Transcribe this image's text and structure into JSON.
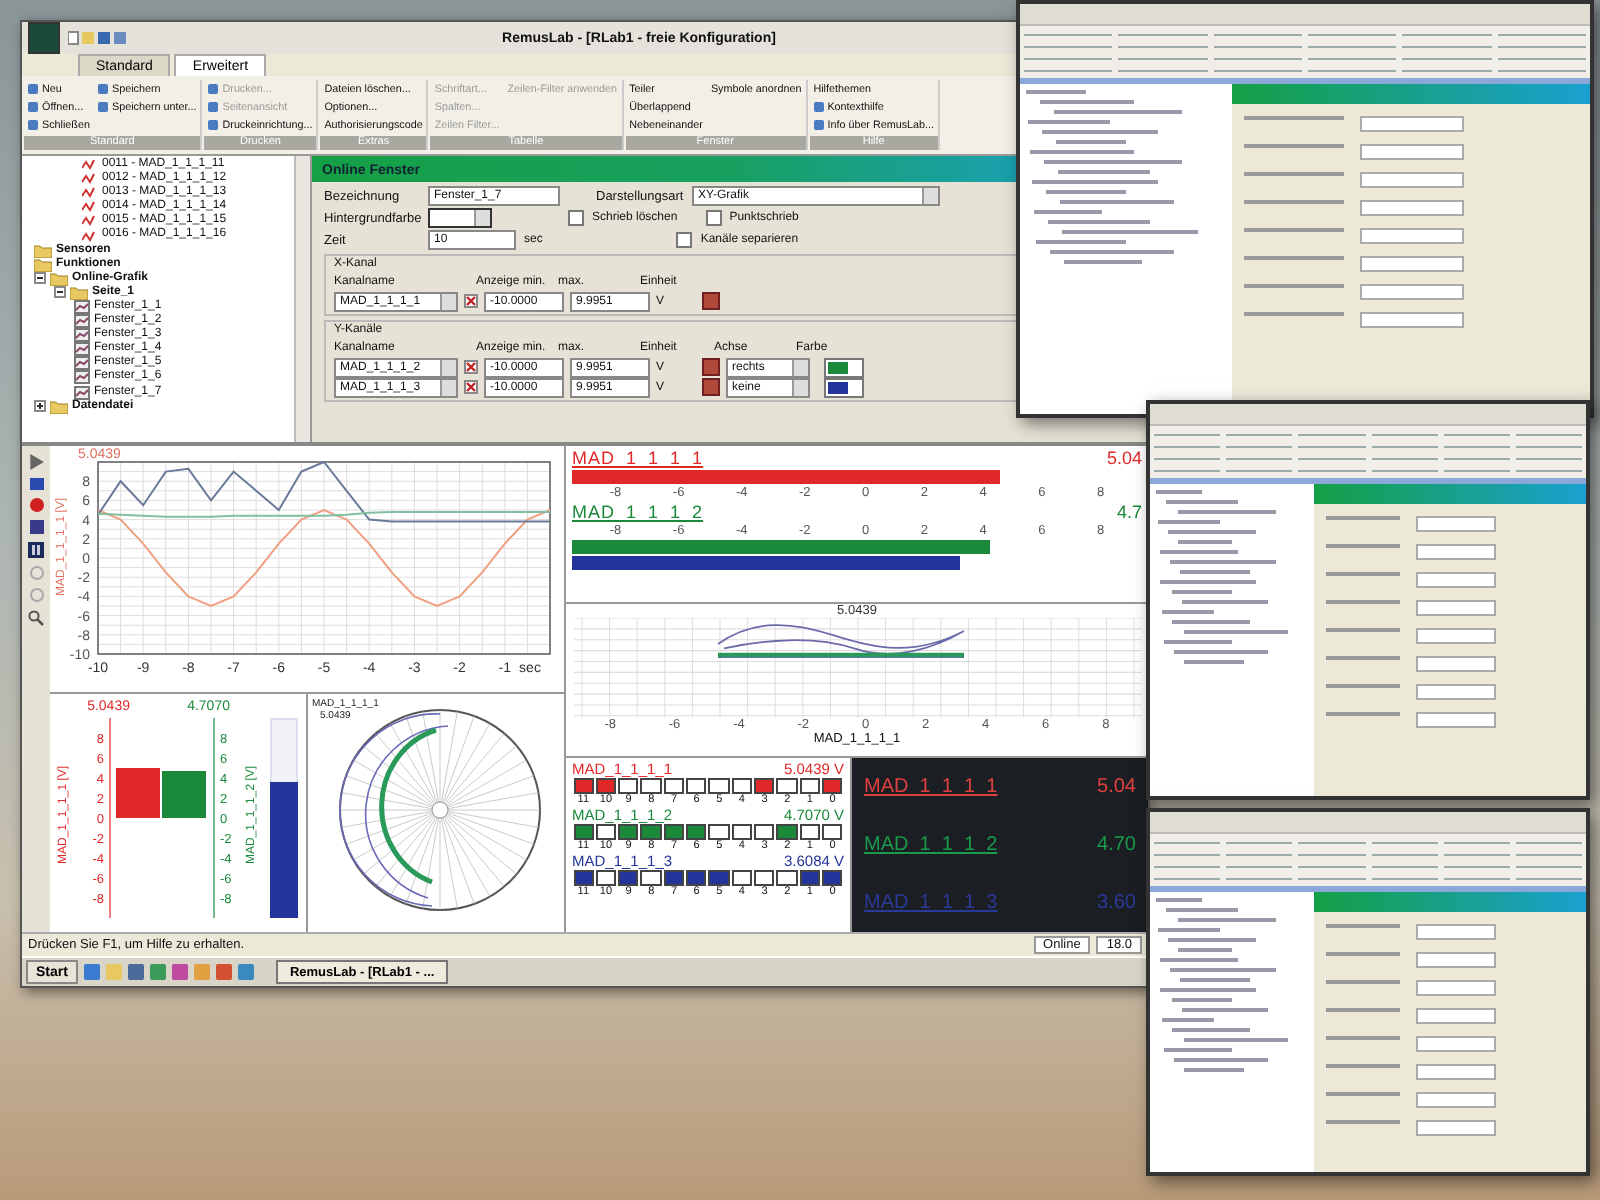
{
  "window": {
    "title": "RemusLab - [RLab1 - freie Konfiguration]"
  },
  "tabs": [
    {
      "label": "Standard",
      "selected": false
    },
    {
      "label": "Erweitert",
      "selected": true
    }
  ],
  "ribbon": [
    {
      "title": "Standard",
      "items": [
        {
          "label": "Neu",
          "disabled": false,
          "icon": true
        },
        {
          "label": "Öffnen...",
          "disabled": false,
          "icon": true
        },
        {
          "label": "Schließen",
          "disabled": false,
          "icon": true
        },
        {
          "label": "Speichern",
          "disabled": false,
          "icon": true
        },
        {
          "label": "Speichern unter...",
          "disabled": false,
          "icon": true
        }
      ]
    },
    {
      "title": "Drucken",
      "items": [
        {
          "label": "Drucken...",
          "disabled": true,
          "icon": true
        },
        {
          "label": "Seitenansicht",
          "disabled": true,
          "icon": true
        },
        {
          "label": "Druckeinrichtung...",
          "disabled": false,
          "icon": true
        }
      ]
    },
    {
      "title": "Extras",
      "items": [
        {
          "label": "Dateien löschen...",
          "disabled": false,
          "icon": false
        },
        {
          "label": "Optionen...",
          "disabled": false,
          "icon": false
        },
        {
          "label": "Authorisierungscode",
          "disabled": false,
          "icon": false
        }
      ]
    },
    {
      "title": "Tabelle",
      "items": [
        {
          "label": "Schriftart...",
          "disabled": true,
          "icon": false
        },
        {
          "label": "Spalten...",
          "disabled": true,
          "icon": false
        },
        {
          "label": "Zeilen Filter...",
          "disabled": true,
          "icon": false
        },
        {
          "label": "Zeilen-Filter anwenden",
          "disabled": true,
          "icon": false
        }
      ]
    },
    {
      "title": "Fenster",
      "items": [
        {
          "label": "Teiler",
          "disabled": false,
          "icon": false
        },
        {
          "label": "Überlappend",
          "disabled": false,
          "icon": false
        },
        {
          "label": "Nebeneinander",
          "disabled": false,
          "icon": false
        },
        {
          "label": "Symbole anordnen",
          "disabled": false,
          "icon": false
        }
      ]
    },
    {
      "title": "Hilfe",
      "items": [
        {
          "label": "Hilfethemen",
          "disabled": false,
          "icon": false
        },
        {
          "label": "Kontexthilfe",
          "disabled": false,
          "icon": true
        },
        {
          "label": "Info über RemusLab...",
          "disabled": false,
          "icon": true
        }
      ]
    }
  ],
  "tree": [
    {
      "label": "0011 - MAD_1_1_1_11",
      "kind": "channel"
    },
    {
      "label": "0012 - MAD_1_1_1_12",
      "kind": "channel"
    },
    {
      "label": "0013 - MAD_1_1_1_13",
      "kind": "channel"
    },
    {
      "label": "0014 - MAD_1_1_1_14",
      "kind": "channel"
    },
    {
      "label": "0015 - MAD_1_1_1_15",
      "kind": "channel"
    },
    {
      "label": "0016 - MAD_1_1_1_16",
      "kind": "channel"
    },
    {
      "label": "Sensoren",
      "kind": "folder"
    },
    {
      "label": "Funktionen",
      "kind": "folder"
    },
    {
      "label": "Online-Grafik",
      "kind": "folder",
      "expanded": true,
      "children": [
        {
          "label": "Seite_1",
          "kind": "folder",
          "expanded": true,
          "children": [
            {
              "label": "Fenster_1_1",
              "kind": "window"
            },
            {
              "label": "Fenster_1_2",
              "kind": "window"
            },
            {
              "label": "Fenster_1_3",
              "kind": "window"
            },
            {
              "label": "Fenster_1_4",
              "kind": "window"
            },
            {
              "label": "Fenster_1_5",
              "kind": "window"
            },
            {
              "label": "Fenster_1_6",
              "kind": "window"
            },
            {
              "label": "Fenster_1_7",
              "kind": "window"
            }
          ]
        }
      ]
    },
    {
      "label": "Datendatei",
      "kind": "folder",
      "expanded": false
    }
  ],
  "form": {
    "title": "Online Fenster",
    "name_label": "Bezeichnung",
    "name_value": "Fenster_1_7",
    "type_label": "Darstellungsart",
    "type_value": "XY-Grafik",
    "bg_label": "Hintergrundfarbe",
    "time_label": "Zeit",
    "time_value": "10",
    "time_unit": "sec",
    "checkboxes": [
      {
        "label": "Schrieb löschen",
        "checked": false
      },
      {
        "label": "Punktschrieb",
        "checked": false
      },
      {
        "label": "Kanäle separieren",
        "checked": false
      }
    ],
    "x_group": {
      "title": "X-Kanal",
      "columns": [
        "Kanalname",
        "Anzeige min.",
        "max.",
        "Einheit"
      ],
      "rows": [
        {
          "channel": "MAD_1_1_1_1",
          "min": "-10.0000",
          "max": "9.9951",
          "unit": "V"
        }
      ]
    },
    "y_group": {
      "title": "Y-Kanäle",
      "columns": [
        "Kanalname",
        "Anzeige min.",
        "max.",
        "Einheit",
        "Achse",
        "Farbe"
      ],
      "rows": [
        {
          "channel": "MAD_1_1_1_2",
          "min": "-10.0000",
          "max": "9.9951",
          "unit": "V",
          "axis": "rechts",
          "color": "#1a8a3a"
        },
        {
          "channel": "MAD_1_1_1_3",
          "min": "-10.0000",
          "max": "9.9951",
          "unit": "V",
          "axis": "keine",
          "color": "#23359a"
        }
      ]
    }
  },
  "line_chart": {
    "chart_data": {
      "type": "line",
      "grid": true,
      "title": "5.0439",
      "xlabel": "sec",
      "ylabel": "MAD_1_1_1_1 [V]",
      "xlim": [
        -10,
        0
      ],
      "ylim": [
        -10,
        10
      ],
      "xticks": [
        -10,
        -9,
        -8,
        -7,
        -6,
        -5,
        -4,
        -3,
        -2,
        -1
      ],
      "yticks": [
        -10,
        -8,
        -6,
        -4,
        -2,
        0,
        2,
        4,
        6,
        8
      ],
      "x": [
        -10,
        -9.5,
        -9,
        -8.5,
        -8,
        -7.5,
        -7,
        -6.5,
        -6,
        -5.5,
        -5,
        -4.5,
        -4,
        -3.5,
        -3,
        -2.5,
        -2,
        -1.5,
        -1,
        -0.5,
        0
      ],
      "series": [
        {
          "color": "#f0a080",
          "values": [
            5,
            4,
            1.5,
            -1.5,
            -4,
            -5,
            -4,
            -1.5,
            1.5,
            4,
            5,
            4,
            1.5,
            -1.5,
            -4,
            -5,
            -4,
            -1.5,
            1.5,
            4,
            5
          ]
        },
        {
          "color": "#6a7a9a",
          "values": [
            4.5,
            8,
            5.5,
            9,
            9.3,
            6,
            9,
            7,
            5,
            9,
            10,
            7,
            4,
            3.8,
            3.8,
            3.8,
            3.8,
            3.8,
            3.8,
            3.8,
            3.8
          ]
        },
        {
          "color": "#80c0a0",
          "values": [
            4.6,
            4.5,
            4.4,
            4.3,
            4.3,
            4.3,
            4.4,
            4.4,
            4.4,
            4.4,
            4.4,
            4.5,
            4.7,
            4.8,
            4.8,
            4.8,
            4.8,
            4.8,
            4.8,
            4.8,
            4.8
          ]
        }
      ]
    }
  },
  "meters": [
    {
      "kind": "below",
      "name": "MAD_1_1_1_1",
      "value": "5.04",
      "color": "#e02828",
      "level": 0.752,
      "scale": [
        "-8",
        "-6",
        "-4",
        "-2",
        "0",
        "2",
        "4",
        "6",
        "8"
      ]
    },
    {
      "kind": "above",
      "name": "MAD_1_1_1_2",
      "value": "4.7",
      "color": "#1a8a3a",
      "level": 0.735,
      "scale": [
        "-8",
        "-6",
        "-4",
        "-2",
        "0",
        "2",
        "4",
        "6",
        "8"
      ]
    },
    {
      "kind": "plain",
      "color": "#23359a",
      "level": 0.68
    }
  ],
  "xy_plot": {
    "title": "5.0439",
    "xticks": [
      "-8",
      "-6",
      "-4",
      "-2",
      "0",
      "2",
      "4",
      "6",
      "8"
    ],
    "xlabel": "MAD_1_1_1_1"
  },
  "bar_chart": {
    "side_bar": {
      "color": "#23359a",
      "level": 0.68
    },
    "right_axis_ticks": [
      "8",
      "6",
      "4",
      "2",
      "0",
      "-2",
      "-4",
      "-6",
      "-8"
    ],
    "chart_data": {
      "type": "bar",
      "ylim": [
        -10,
        10
      ],
      "yticks": [
        -8,
        -6,
        -4,
        -2,
        0,
        2,
        4,
        6,
        8
      ],
      "value_labels": [
        "5.0439",
        "4.7070"
      ],
      "series": [
        {
          "name": "MAD_1_1_1_1 [V]",
          "color": "#e02828",
          "values": [
            5.0
          ]
        },
        {
          "name": "MAD_1_1_1_2 [V]",
          "color": "#1a8a3a",
          "values": [
            4.7
          ]
        }
      ]
    }
  },
  "polar_plot": {
    "name": "MAD_1_1_1_1",
    "value": "5.0439"
  },
  "bit_displays": [
    {
      "name": "MAD_1_1_1_1",
      "value": "5.0439 V",
      "color": "#e02828",
      "bits": [
        {
          "label": "11",
          "on": true
        },
        {
          "label": "10",
          "on": true
        },
        {
          "label": "9",
          "on": false
        },
        {
          "label": "8",
          "on": false
        },
        {
          "label": "7",
          "on": false
        },
        {
          "label": "6",
          "on": false
        },
        {
          "label": "5",
          "on": false
        },
        {
          "label": "4",
          "on": false
        },
        {
          "label": "3",
          "on": true
        },
        {
          "label": "2",
          "on": false
        },
        {
          "label": "1",
          "on": false
        },
        {
          "label": "0",
          "on": true
        }
      ]
    },
    {
      "name": "MAD_1_1_1_2",
      "value": "4.7070 V",
      "color": "#1a8a3a",
      "bits": [
        {
          "label": "11",
          "on": true
        },
        {
          "label": "10",
          "on": false
        },
        {
          "label": "9",
          "on": true
        },
        {
          "label": "8",
          "on": true
        },
        {
          "label": "7",
          "on": true
        },
        {
          "label": "6",
          "on": true
        },
        {
          "label": "5",
          "on": false
        },
        {
          "label": "4",
          "on": false
        },
        {
          "label": "3",
          "on": false
        },
        {
          "label": "2",
          "on": true
        },
        {
          "label": "1",
          "on": false
        },
        {
          "label": "0",
          "on": false
        }
      ]
    },
    {
      "name": "MAD_1_1_1_3",
      "value": "3.6084 V",
      "color": "#23359a",
      "bits": [
        {
          "label": "11",
          "on": true
        },
        {
          "label": "10",
          "on": false
        },
        {
          "label": "9",
          "on": true
        },
        {
          "label": "8",
          "on": false
        },
        {
          "label": "7",
          "on": true
        },
        {
          "label": "6",
          "on": true
        },
        {
          "label": "5",
          "on": true
        },
        {
          "label": "4",
          "on": false
        },
        {
          "label": "3",
          "on": false
        },
        {
          "label": "2",
          "on": false
        },
        {
          "label": "1",
          "on": true
        },
        {
          "label": "0",
          "on": true
        }
      ]
    }
  ],
  "digital_display": [
    {
      "name": "MAD_1_1_1_1",
      "value": "5.04",
      "color": "#e04040"
    },
    {
      "name": "MAD_1_1_1_2",
      "value": "4.70",
      "color": "#1a9a4a"
    },
    {
      "name": "MAD_1_1_1_3",
      "value": "3.60",
      "color": "#2a3a9a"
    }
  ],
  "status_bar": {
    "text": "Drücken Sie F1, um Hilfe zu erhalten.",
    "mode": "Online",
    "time": "18.0"
  },
  "taskbar": {
    "start": "Start",
    "task": "RemusLab - [RLab1 - ..."
  }
}
